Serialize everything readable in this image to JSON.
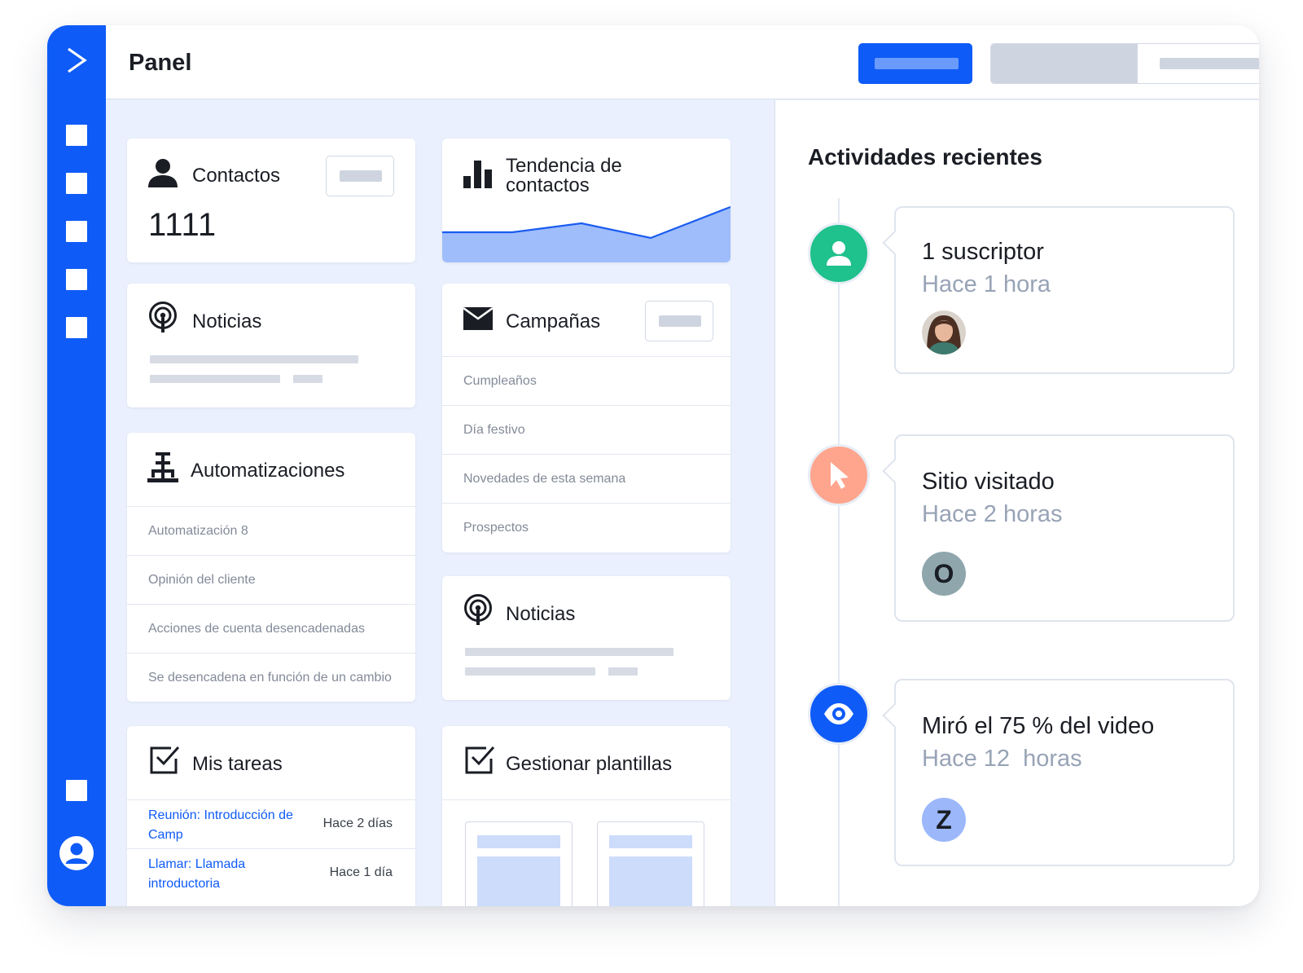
{
  "header": {
    "title": "Panel"
  },
  "sidebar": {
    "icons": [
      "logo-chevron-icon",
      "nav-square-icon",
      "nav-square-icon",
      "nav-square-icon",
      "nav-square-icon",
      "nav-square-icon",
      "nav-square-icon",
      "user-icon"
    ]
  },
  "cards": {
    "contacts": {
      "title": "Contactos",
      "value": "1111",
      "icon": "person-icon"
    },
    "trend": {
      "title_line1": "Tendencia de",
      "title_line2": "contactos",
      "icon": "bar-chart-icon"
    },
    "news1": {
      "title": "Noticias",
      "icon": "podcast-icon"
    },
    "campaigns": {
      "title": "Campañas",
      "icon": "envelope-icon",
      "items": [
        "Cumpleaños",
        "Día festivo",
        "Novedades de esta semana",
        "Prospectos"
      ]
    },
    "automations": {
      "title": "Automatizaciones",
      "icon": "workflow-icon",
      "items": [
        "Automatización 8",
        "Opinión del cliente",
        "Acciones de cuenta desencadenadas",
        "Se desencadena en función de un cambio"
      ]
    },
    "news2": {
      "title": "Noticias",
      "icon": "podcast-icon"
    },
    "tasks": {
      "title": "Mis tareas",
      "icon": "checkbox-icon",
      "items": [
        {
          "label": "Reunión: Introducción de Camp",
          "when": "Hace 2 días"
        },
        {
          "label": "Llamar: Llamada introductoria",
          "when": "Hace 1 día"
        }
      ]
    },
    "templates": {
      "title": "Gestionar plantillas",
      "icon": "checkbox-icon"
    }
  },
  "activity": {
    "title": "Actividades recientes",
    "items": [
      {
        "title": "1 suscriptor",
        "time": "Hace 1 hora",
        "icon": "person-icon",
        "color": "#1fc18c",
        "avatar_letter": ""
      },
      {
        "title": "Sitio visitado",
        "time": "Hace 2 horas",
        "icon": "cursor-icon",
        "color": "#ffa58e",
        "avatar_letter": "O"
      },
      {
        "title": "Miró el 75 % del video",
        "time": "Hace 12  horas",
        "icon": "eye-icon",
        "color": "#0f5bf7",
        "avatar_letter": "Z"
      }
    ]
  },
  "colors": {
    "brand": "#0f5bf7",
    "background": "#eaf0fd",
    "chart_fill": "#9fbdfb",
    "muted_text": "#98a3b6"
  }
}
